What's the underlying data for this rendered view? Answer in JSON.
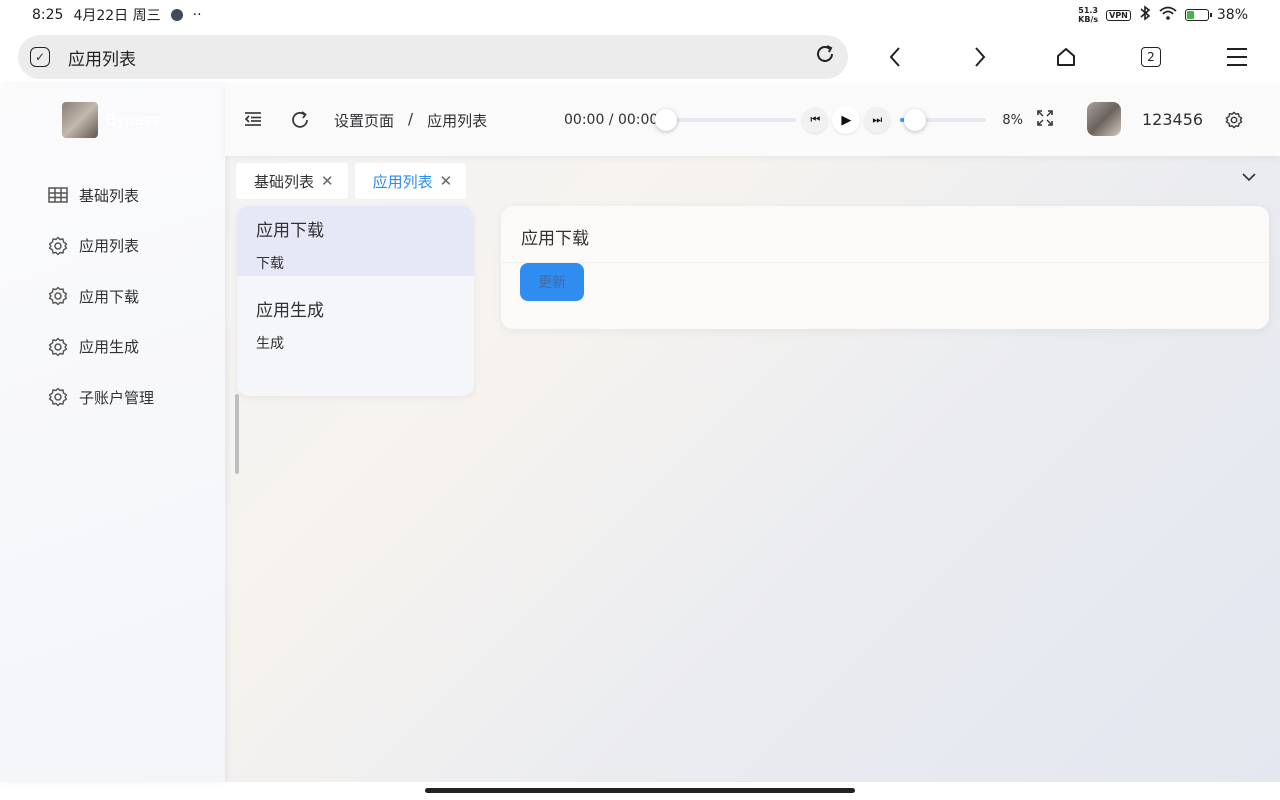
{
  "statusbar": {
    "time": "8:25",
    "date": "4月22日 周三",
    "dots": "··",
    "netspeed_value": "51.3",
    "netspeed_unit": "KB/s",
    "vpn": "VPN",
    "battery": "38%",
    "battery_level": 0.38
  },
  "browser": {
    "url_title": "应用列表",
    "tab_count": "2",
    "icons": [
      "shield-check-icon",
      "reload-icon",
      "back-icon",
      "forward-icon",
      "home-icon",
      "tabs-icon",
      "menu-icon"
    ]
  },
  "sidebar": {
    "logo_text": "Bypass",
    "items": [
      {
        "label": "基础列表",
        "icon": "grid-icon"
      },
      {
        "label": "应用列表",
        "icon": "gear-icon"
      },
      {
        "label": "应用下载",
        "icon": "gear-icon"
      },
      {
        "label": "应用生成",
        "icon": "gear-icon"
      },
      {
        "label": "子账户管理",
        "icon": "gear-icon"
      }
    ]
  },
  "header": {
    "breadcrumb": [
      "设置页面",
      "/",
      "应用列表"
    ],
    "player_time": "00:00 / 00:00",
    "player_progress": 0,
    "volume_value": 0.08,
    "volume_pct": "8%",
    "username": "123456"
  },
  "tags": [
    {
      "label": "基础列表",
      "active": false
    },
    {
      "label": "应用列表",
      "active": true
    }
  ],
  "list": [
    {
      "title": "应用下载",
      "sub": "下载",
      "selected": true
    },
    {
      "title": "应用生成",
      "sub": "生成",
      "selected": false
    }
  ],
  "detail": {
    "title": "应用下载",
    "button": "更新"
  },
  "colors": {
    "accent": "#2d8cf0",
    "button_bg": "#2f8cf0",
    "selected_row": "#e6e8f8"
  }
}
